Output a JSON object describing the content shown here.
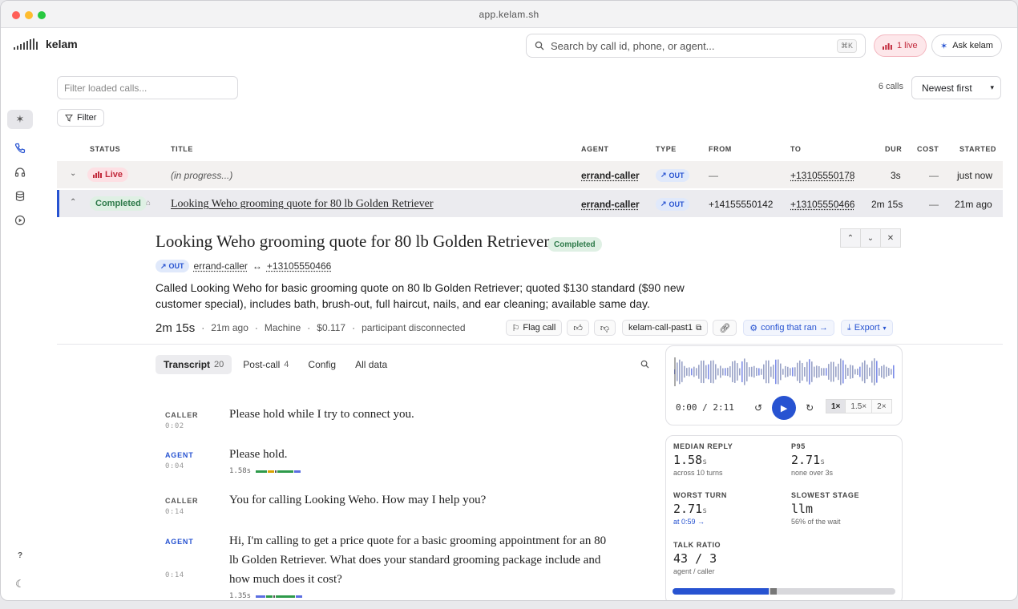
{
  "window": {
    "url": "app.kelam.sh"
  },
  "brand": {
    "name": "kelam"
  },
  "search": {
    "placeholder": "Search by call id, phone, or agent...",
    "shortcut": "⌘K"
  },
  "header": {
    "live_label": "1 live",
    "ask_label": "Ask kelam"
  },
  "calls": {
    "filter_placeholder": "Filter loaded calls...",
    "count_label": "6 calls",
    "sort_label": "Newest first",
    "filter_button": "Filter",
    "columns": [
      "STATUS",
      "TITLE",
      "AGENT",
      "TYPE",
      "FROM",
      "TO",
      "DUR",
      "COST",
      "STARTED"
    ],
    "rows": [
      {
        "status": "Live",
        "title": "(in progress...)",
        "agent": "errand-caller",
        "type": "OUT",
        "from": "—",
        "to": "+13105550178",
        "dur": "3s",
        "cost": "—",
        "started": "just now"
      },
      {
        "status": "Completed",
        "title": "Looking Weho grooming quote for 80 lb Golden Retriever",
        "agent": "errand-caller",
        "type": "OUT",
        "from": "+14155550142",
        "to": "+13105550466",
        "dur": "2m 15s",
        "cost": "—",
        "started": "21m ago"
      }
    ]
  },
  "detail": {
    "title": "Looking Weho grooming quote for 80 lb Golden Retriever",
    "status": "Completed",
    "type": "OUT",
    "agent": "errand-caller",
    "arrow": "↔",
    "to": "+13105550466",
    "summary": "Called Looking Weho for basic grooming quote on 80 lb Golden Retriever; quoted $130 standard ($90 new customer special), includes bath, brush-out, full haircut, nails, and ear cleaning; available same day.",
    "duration": "2m 15s",
    "started": "21m ago",
    "answered_by": "Machine",
    "cost": "$0.117",
    "end_reason": "participant disconnected",
    "flag_label": "Flag call",
    "call_id": "kelam-call-past1",
    "config_label": "config that ran →",
    "export_label": "Export"
  },
  "tabs": [
    {
      "label": "Transcript",
      "count": "20"
    },
    {
      "label": "Post-call",
      "count": "4"
    },
    {
      "label": "Config",
      "count": ""
    },
    {
      "label": "All data",
      "count": ""
    }
  ],
  "transcript": [
    {
      "speaker": "CALLER",
      "time": "0:02",
      "text": "Please hold while I try to connect you.",
      "latency": ""
    },
    {
      "speaker": "AGENT",
      "time": "0:04",
      "text": "Please hold.",
      "latency": "1.58s"
    },
    {
      "speaker": "CALLER",
      "time": "0:14",
      "text": "You for calling Looking Weho. How may I help you?",
      "latency": ""
    },
    {
      "speaker": "AGENT",
      "time": "0:14",
      "text": "Hi, I'm calling to get a price quote for a basic grooming appointment for an 80 lb Golden Retriever. What does your standard grooming package include and how much does it cost?",
      "latency": "1.35s"
    }
  ],
  "player": {
    "time": "0:00 / 2:11",
    "progress": 0,
    "speeds": [
      "1×",
      "1.5×",
      "2×"
    ],
    "active_speed": "1×"
  },
  "stats": {
    "median_reply": {
      "label": "MEDIAN REPLY",
      "value": "1.58",
      "unit": "s",
      "sub": "across 10 turns"
    },
    "p95": {
      "label": "P95",
      "value": "2.71",
      "unit": "s",
      "sub": "none over 3s"
    },
    "worst_turn": {
      "label": "WORST TURN",
      "value": "2.71",
      "unit": "s",
      "sub": "at 0:59 →"
    },
    "slowest_stage": {
      "label": "SLOWEST STAGE",
      "value": "llm",
      "sub": "56% of the wait"
    },
    "talk_ratio": {
      "label": "TALK RATIO",
      "value": "43 / 3",
      "sub": "agent / caller",
      "agent_share": 0.43,
      "caller_share": 0.03
    }
  },
  "colors": {
    "accent": "#2753d1",
    "live": "#c22a3c",
    "completed": "#2e7a4a"
  }
}
